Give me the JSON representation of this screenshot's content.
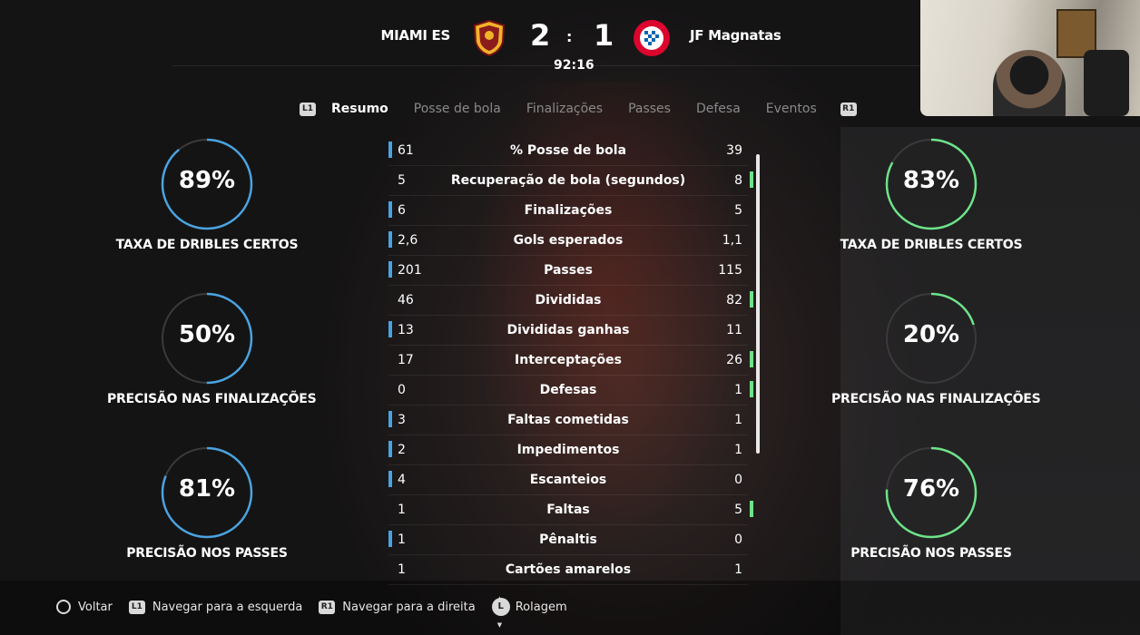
{
  "match": {
    "home_team": "MIAMI ES",
    "away_team": "JF Magnatas",
    "home_score": "2",
    "away_score": "1",
    "separator": ":",
    "clock": "92:16",
    "home_color": "#4aa3e0",
    "away_color": "#6ee38a"
  },
  "tabs": {
    "l1_badge": "L1",
    "r1_badge": "R1",
    "items": [
      "Resumo",
      "Posse de bola",
      "Finalizações",
      "Passes",
      "Defesa",
      "Eventos"
    ]
  },
  "home_gauges": [
    {
      "value": "89%",
      "fraction": 0.89,
      "label": "TAXA DE DRIBLES CERTOS"
    },
    {
      "value": "50%",
      "fraction": 0.5,
      "label": "PRECISÃO NAS FINALIZAÇÕES"
    },
    {
      "value": "81%",
      "fraction": 0.81,
      "label": "PRECISÃO NOS PASSES"
    }
  ],
  "away_gauges": [
    {
      "value": "83%",
      "fraction": 0.83,
      "label": "TAXA DE DRIBLES CERTOS"
    },
    {
      "value": "20%",
      "fraction": 0.2,
      "label": "PRECISÃO NAS FINALIZAÇÕES"
    },
    {
      "value": "76%",
      "fraction": 0.76,
      "label": "PRECISÃO NOS PASSES"
    }
  ],
  "stats": [
    {
      "home": "61",
      "label": "% Posse de bola",
      "away": "39",
      "leader": "home"
    },
    {
      "home": "5",
      "label": "Recuperação de bola (segundos)",
      "away": "8",
      "leader": "away"
    },
    {
      "home": "6",
      "label": "Finalizações",
      "away": "5",
      "leader": "home"
    },
    {
      "home": "2,6",
      "label": "Gols esperados",
      "away": "1,1",
      "leader": "home"
    },
    {
      "home": "201",
      "label": "Passes",
      "away": "115",
      "leader": "home"
    },
    {
      "home": "46",
      "label": "Divididas",
      "away": "82",
      "leader": "away"
    },
    {
      "home": "13",
      "label": "Divididas ganhas",
      "away": "11",
      "leader": "home"
    },
    {
      "home": "17",
      "label": "Interceptações",
      "away": "26",
      "leader": "away"
    },
    {
      "home": "0",
      "label": "Defesas",
      "away": "1",
      "leader": "away"
    },
    {
      "home": "3",
      "label": "Faltas cometidas",
      "away": "1",
      "leader": "home"
    },
    {
      "home": "2",
      "label": "Impedimentos",
      "away": "1",
      "leader": "home"
    },
    {
      "home": "4",
      "label": "Escanteios",
      "away": "0",
      "leader": "home"
    },
    {
      "home": "1",
      "label": "Faltas",
      "away": "5",
      "leader": "away"
    },
    {
      "home": "1",
      "label": "Pênaltis",
      "away": "0",
      "leader": "home"
    },
    {
      "home": "1",
      "label": "Cartões amarelos",
      "away": "1",
      "leader": "none"
    }
  ],
  "footer": {
    "back": "Voltar",
    "nav_left_badge": "L1",
    "nav_left": "Navegar para a esquerda",
    "nav_right_badge": "R1",
    "nav_right": "Navegar para a direita",
    "scroll_badge": "L",
    "scroll": "Rolagem"
  }
}
